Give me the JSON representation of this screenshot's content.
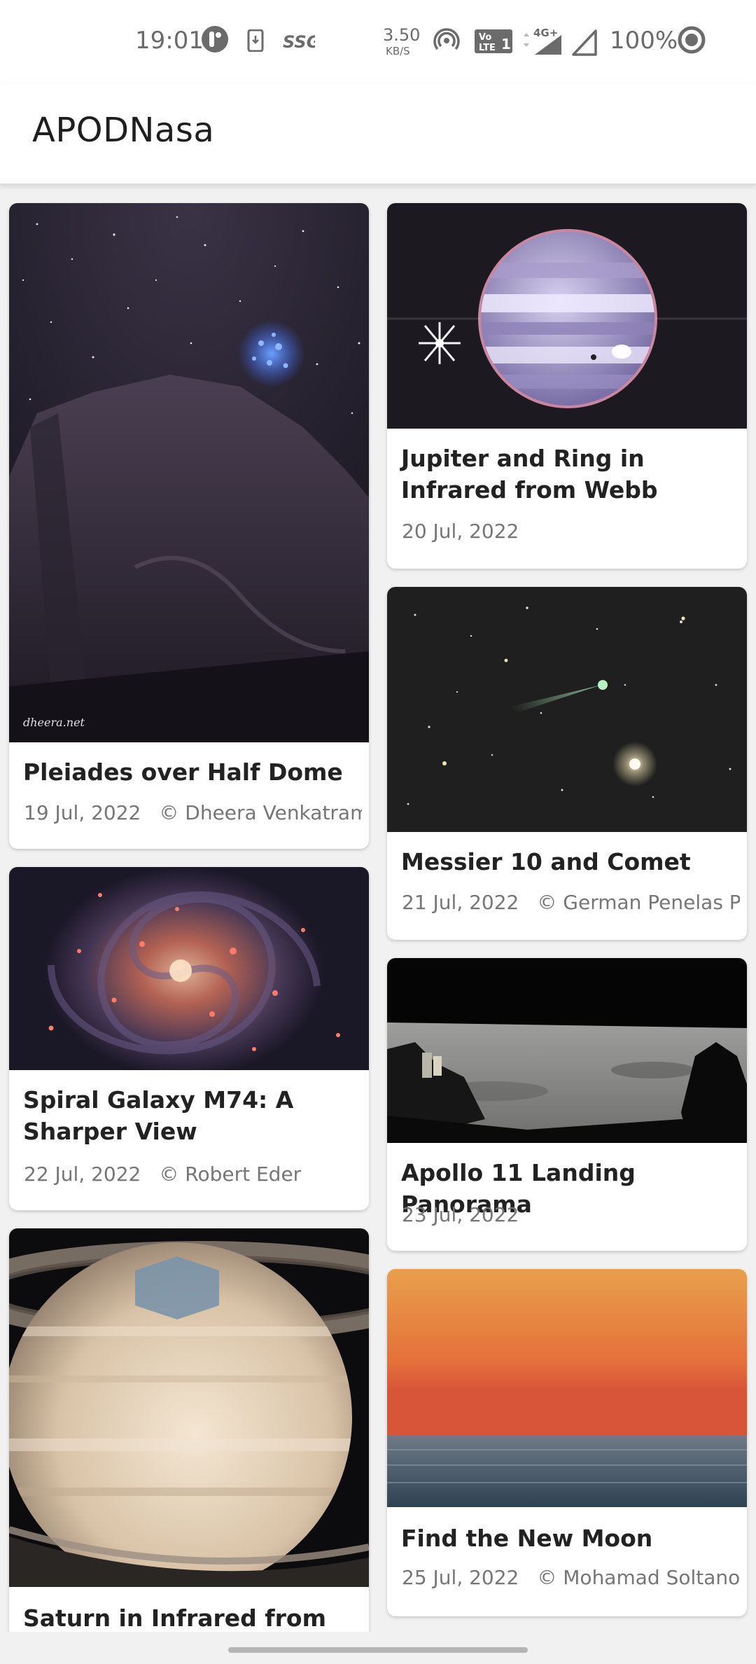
{
  "status_bar": {
    "time": "19:01",
    "speed_value": "3.50",
    "speed_unit": "KB/S",
    "network": "4G+",
    "volte": "Vo LTE 1",
    "battery": "100%",
    "icons": [
      "phone-ring-icon",
      "sim-icon",
      "ssg-icon",
      "hotspot-icon",
      "signal-icon",
      "battery-ring-icon"
    ]
  },
  "app_bar": {
    "title": "APODNasa"
  },
  "cards": [
    {
      "title": "Pleiades over Half Dome",
      "date": "19 Jul, 2022",
      "copyright": "© Dheera Venkatraman",
      "image_watermark": "dheera.net"
    },
    {
      "title": "Jupiter and Ring in Infrared from Webb",
      "date": "20 Jul, 2022",
      "copyright": ""
    },
    {
      "title": "Messier 10 and Comet",
      "date": "21 Jul, 2022",
      "copyright": "© German Penelas Pe..."
    },
    {
      "title": "Spiral Galaxy M74: A Sharper View",
      "date": "22 Jul, 2022",
      "copyright": "© Robert Eder"
    },
    {
      "title": "Apollo 11 Landing Panorama",
      "date": "23 Jul, 2022",
      "copyright": ""
    },
    {
      "title": "Saturn in Infrared from",
      "date": "",
      "copyright": ""
    },
    {
      "title": "Find the New Moon",
      "date": "25 Jul, 2022",
      "copyright": "© Mohamad Soltanol..."
    }
  ]
}
